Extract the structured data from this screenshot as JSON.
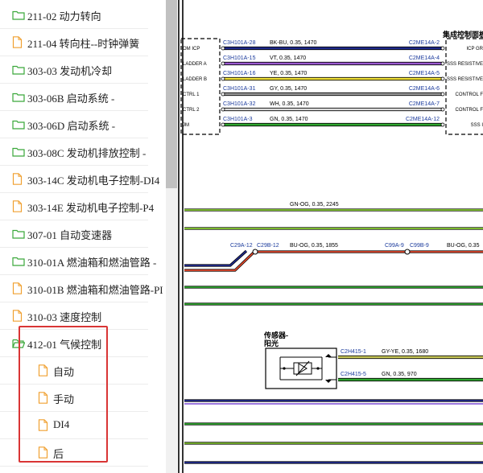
{
  "tree": {
    "items": [
      {
        "label": "211-02 动力转向",
        "icon": "folder",
        "level": 0
      },
      {
        "label": "211-04 转向柱--时钟弹簧",
        "icon": "document",
        "level": 0
      },
      {
        "label": "303-03 发动机冷却",
        "icon": "folder",
        "level": 0
      },
      {
        "label": "303-06B 启动系统 -",
        "icon": "folder",
        "level": 0
      },
      {
        "label": "303-06D 启动系统 -",
        "icon": "folder",
        "level": 0
      },
      {
        "label": "303-08C 发动机排放控制 -",
        "icon": "folder",
        "level": 0
      },
      {
        "label": "303-14C 发动机电子控制-DI4",
        "icon": "document",
        "level": 0
      },
      {
        "label": "303-14E 发动机电子控制-P4",
        "icon": "document",
        "level": 0
      },
      {
        "label": "307-01 自动变速器",
        "icon": "folder",
        "level": 0
      },
      {
        "label": "310-01A 燃油箱和燃油管路 -",
        "icon": "folder",
        "level": 0
      },
      {
        "label": "310-01B 燃油箱和燃油管路-PI",
        "icon": "document",
        "level": 0
      },
      {
        "label": "310-03 速度控制",
        "icon": "document",
        "level": 0
      },
      {
        "label": "412-01 气候控制",
        "icon": "folder-open",
        "level": 0
      },
      {
        "label": "自动",
        "icon": "document",
        "level": 1
      },
      {
        "label": "手动",
        "icon": "document",
        "level": 1
      },
      {
        "label": "DI4",
        "icon": "document",
        "level": 1
      },
      {
        "label": "后",
        "icon": "document",
        "level": 1
      }
    ]
  },
  "colors": {
    "folder": "#3aa83a",
    "document": "#f0a030",
    "highlight": "#d93535"
  },
  "diagram": {
    "module_title": "集成控制面板",
    "left_pins": [
      "OM ICP",
      "LADDER A",
      "LADDER B",
      "CTRL 1",
      "CTRL 2",
      "JM"
    ],
    "wires": [
      {
        "from": "C3H101A-28",
        "spec": "BK-BU, 0.35, 1470",
        "to": "C2ME14A-2",
        "right": "ICP GR",
        "color": "#1f2a8c"
      },
      {
        "from": "C3H101A-15",
        "spec": "VT, 0.35, 1470",
        "to": "C2ME14A-4",
        "right": "SSS RESISTIVE",
        "color": "#9b59d0"
      },
      {
        "from": "C3H101A-16",
        "spec": "YE, 0.35, 1470",
        "to": "C2ME14A-5",
        "right": "SSS RESISTIVE",
        "color": "#f2e23a"
      },
      {
        "from": "C3H101A-31",
        "spec": "GY, 0.35, 1470",
        "to": "C2ME14A-6",
        "right": "CONTROL F",
        "color": "#9a9a9a"
      },
      {
        "from": "C3H101A-32",
        "spec": "WH, 0.35, 1470",
        "to": "C2ME14A-7",
        "right": "CONTROL F",
        "color": "#dcdcdc"
      },
      {
        "from": "C3H101A-3",
        "spec": "GN, 0.35, 1470",
        "to": "C2ME14A-12",
        "right": "SSS I",
        "color": "#2fa82f"
      }
    ],
    "gn_og_label": "GN-OG, 0.35, 2245",
    "bu_og_mid": {
      "c1": "C29A-12",
      "c2": "C29B-12",
      "spec": "BU-OG, 0.35, 1855"
    },
    "bu_og_right": {
      "c1": "C99A-9",
      "c2": "C99B-9",
      "spec": "BU-OG, 0.35"
    },
    "sensor_title_1": "传感器-",
    "sensor_title_2": "阳光",
    "sensor_wires": [
      {
        "conn": "C2H415-1",
        "spec": "GY-YE, 0.35, 1680",
        "color": "#c9c95a"
      },
      {
        "conn": "C2H415-5",
        "spec": "GN, 0.35, 970",
        "color": "#2fa82f"
      }
    ]
  }
}
